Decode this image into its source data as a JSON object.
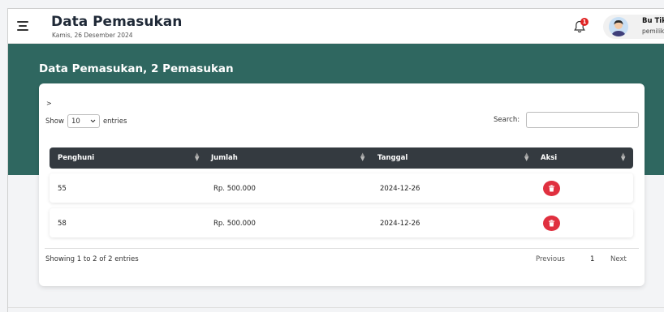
{
  "header": {
    "title": "Data Pemasukan",
    "date": "Kamis, 26 Desember 2024",
    "notification_count": "1",
    "user": {
      "name": "Bu Tik",
      "role": "pemilik"
    }
  },
  "hero": {
    "title": "Data Pemasukan, 2 Pemasukan"
  },
  "table_controls": {
    "chevron": ">",
    "show_label": "Show",
    "length_value": "10",
    "entries_label": "entries",
    "search_label": "Search:",
    "search_value": ""
  },
  "table": {
    "columns": [
      "Penghuni",
      "Jumlah",
      "Tanggal",
      "Aksi"
    ],
    "rows": [
      {
        "penghuni": "55",
        "jumlah": "Rp. 500.000",
        "tanggal": "2024-12-26"
      },
      {
        "penghuni": "58",
        "jumlah": "Rp. 500.000",
        "tanggal": "2024-12-26"
      }
    ]
  },
  "footer": {
    "info": "Showing 1 to 2 of 2 entries",
    "previous": "Previous",
    "page": "1",
    "next": "Next"
  },
  "colors": {
    "hero": "#2f6760",
    "table_head": "#343a40",
    "delete": "#e0303f",
    "badge": "#e02424"
  },
  "icons": [
    "menu-icon",
    "bell-icon",
    "avatar",
    "trash-icon",
    "sort-icon"
  ]
}
